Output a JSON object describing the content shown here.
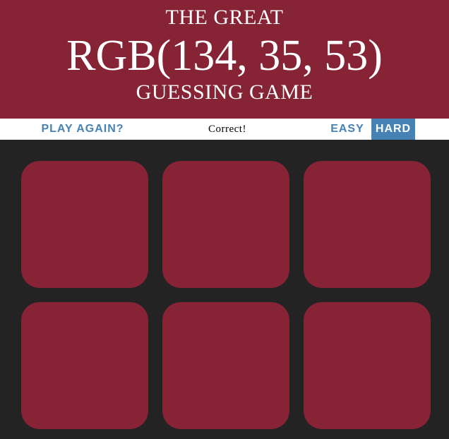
{
  "header": {
    "line1": "THE GREAT",
    "rgb_text": "RGB(134, 35, 53)",
    "line3": "GUESSING GAME",
    "background_color": "#862335"
  },
  "controls": {
    "reset_label": "PLAY AGAIN?",
    "message": "Correct!",
    "easy_label": "EASY",
    "hard_label": "HARD",
    "selected_mode": "HARD"
  },
  "squares": [
    {
      "color": "#862335"
    },
    {
      "color": "#862335"
    },
    {
      "color": "#862335"
    },
    {
      "color": "#862335"
    },
    {
      "color": "#862335"
    },
    {
      "color": "#862335"
    }
  ],
  "colors": {
    "page_background": "#232323",
    "accent": "#4682b4",
    "stripe_background": "#ffffff"
  }
}
